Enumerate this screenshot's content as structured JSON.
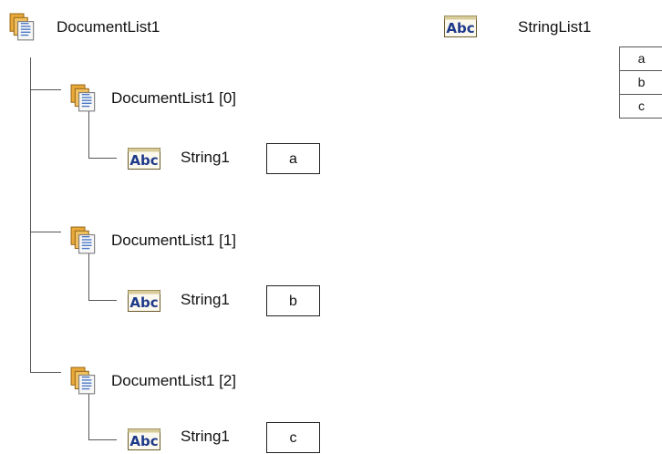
{
  "root": {
    "label": "DocumentList1",
    "icon": "document-list-icon"
  },
  "children": [
    {
      "label": "DocumentList1 [0]",
      "icon": "document-list-icon",
      "string": {
        "label": "String1",
        "icon": "string-abc-icon",
        "value": "a"
      }
    },
    {
      "label": "DocumentList1 [1]",
      "icon": "document-list-icon",
      "string": {
        "label": "String1",
        "icon": "string-abc-icon",
        "value": "b"
      }
    },
    {
      "label": "DocumentList1 [2]",
      "icon": "document-list-icon",
      "string": {
        "label": "String1",
        "icon": "string-abc-icon",
        "value": "c"
      }
    }
  ],
  "string_list": {
    "label": "StringList1",
    "icon": "string-abc-icon",
    "items": [
      "a",
      "b",
      "c"
    ]
  },
  "colors": {
    "abc_text": "#1e3a8a",
    "abc_border": "#6b5a2a",
    "doc_fill": "#e9a93a",
    "doc_page": "#f4f4f4"
  }
}
